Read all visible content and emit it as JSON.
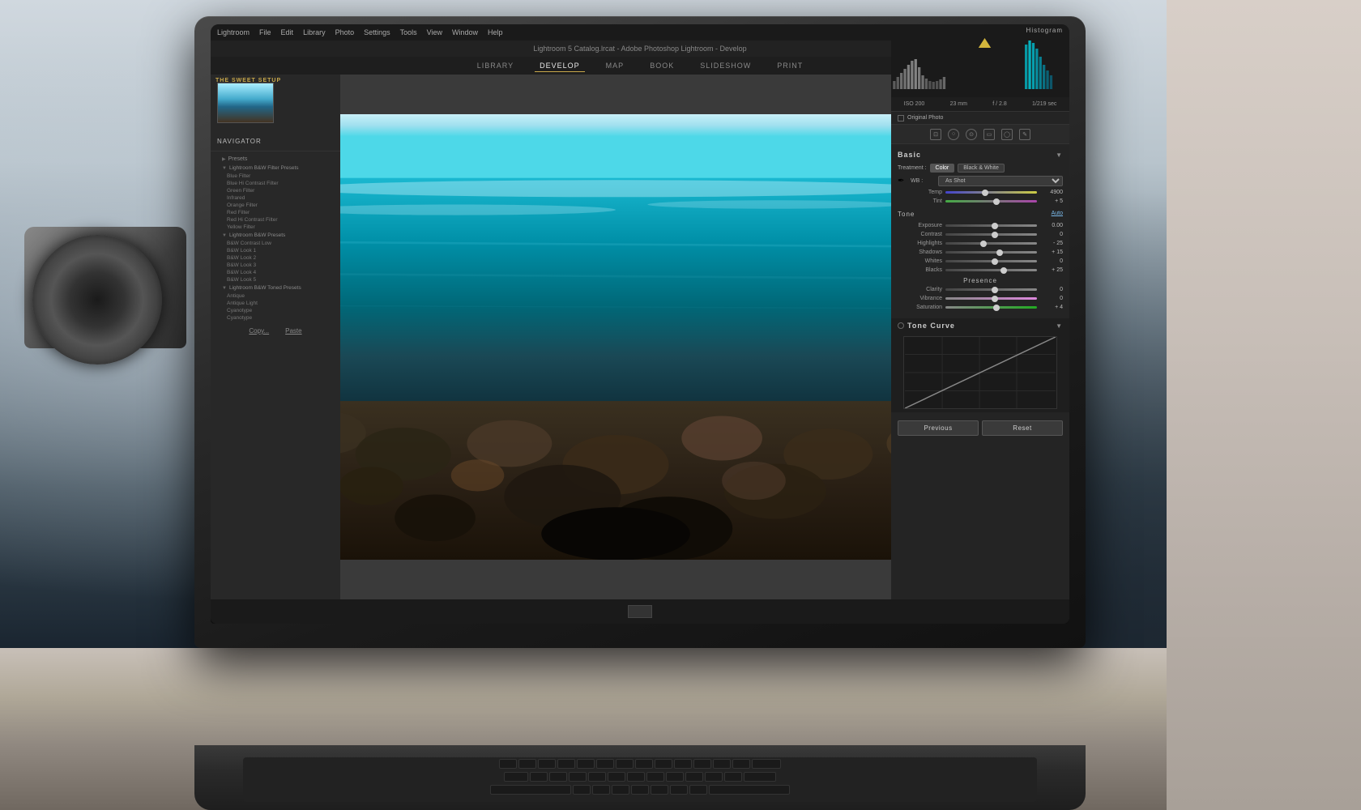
{
  "scene": {
    "background": "photo editing desk scene with laptop and camera"
  },
  "lightroom": {
    "app_title": "Lightroom 5 Catalog.lrcat - Adobe Photoshop Lightroom - Develop",
    "menu": {
      "items": [
        "Lightroom",
        "File",
        "Edit",
        "Library",
        "Photo",
        "Settings",
        "Tools",
        "View",
        "Window",
        "Help"
      ]
    },
    "nav_tabs": {
      "tabs": [
        "LIBRARY",
        "DEVELOP",
        "MAP",
        "BOOK",
        "SLIDESHOW",
        "PRINT"
      ]
    },
    "active_tab": "DEVELOP",
    "left_panel": {
      "title": "Navigator",
      "brand": "THE SWEET SETUP",
      "presets": {
        "title": "Presets",
        "groups": [
          {
            "label": "Lightroom B&W Filter Presets",
            "items": [
              "Blue Filter",
              "Blue Hi Contrast Filter",
              "Green Filter",
              "Infrared",
              "Orange Filter",
              "Red Filter",
              "Red Hi Contrast Filter",
              "Yellow Filter"
            ]
          },
          {
            "label": "Lightroom B&W Presets",
            "items": [
              "B&W Contrast Low",
              "B&W Look 1",
              "B&W Look 2",
              "B&W Look 3",
              "B&W Look 4",
              "B&W Look 5"
            ]
          },
          {
            "label": "Lightroom B&W Toned Presets",
            "items": [
              "Antique",
              "Antique Light",
              "Cyanotype",
              "Cyanotype"
            ]
          }
        ]
      },
      "copy_label": "Copy...",
      "paste_label": "Paste"
    },
    "right_panel": {
      "histogram_title": "Histogram",
      "camera_info": {
        "iso": "ISO 200",
        "focal_length": "23 mm",
        "aperture": "f / 2.8",
        "shutter": "1/219 sec"
      },
      "original_photo_label": "Original Photo",
      "basic_section": {
        "title": "Basic",
        "treatment_label": "Treatment :",
        "color_btn": "Color",
        "bw_btn": "Black & White",
        "wb_label": "WB :",
        "wb_value": "As Shot",
        "temp_label": "Temp",
        "temp_value": "4900",
        "tint_label": "Tint",
        "tint_value": "+ 5",
        "tone_label": "Tone",
        "auto_label": "Auto",
        "exposure_label": "Exposure",
        "exposure_value": "0.00",
        "contrast_label": "Contrast",
        "contrast_value": "0",
        "highlights_label": "Highlights",
        "highlights_value": "- 25",
        "shadows_label": "Shadows",
        "shadows_value": "+ 15",
        "whites_label": "Whites",
        "whites_value": "0",
        "blacks_label": "Blacks",
        "blacks_value": "+ 25",
        "presence_label": "Presence",
        "clarity_label": "Clarity",
        "clarity_value": "0",
        "vibrance_label": "Vibrance",
        "vibrance_value": "0",
        "saturation_label": "Saturation",
        "saturation_value": "+ 4"
      },
      "tone_curve": {
        "title": "Tone Curve"
      },
      "buttons": {
        "previous": "Previous",
        "reset": "Reset"
      }
    }
  }
}
